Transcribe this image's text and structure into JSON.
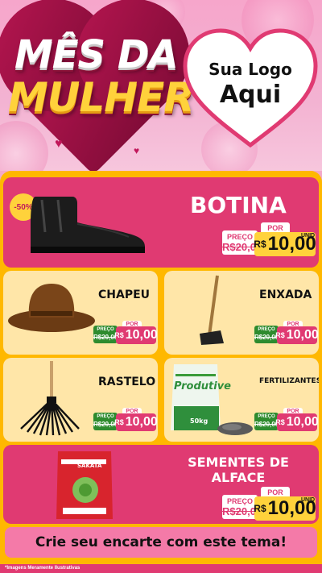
{
  "header": {
    "title_line1": "MÊS DA",
    "title_line2": "MULHER",
    "logo_line1": "Sua Logo",
    "logo_line2": "Aqui"
  },
  "products": [
    {
      "name": "BOTINA",
      "badge": "-50%",
      "por": "POR",
      "old_label": "PREÇO",
      "old_price": "R$20,00",
      "currency": "R$",
      "new_price": "10,00",
      "unit": "UNID"
    },
    {
      "name": "CHAPEU",
      "por": "POR",
      "old_label": "PREÇO",
      "old_price": "R$20,00",
      "currency": "R$",
      "new_price": "10,00"
    },
    {
      "name": "ENXADA",
      "por": "POR",
      "old_label": "PREÇO",
      "old_price": "R$20,00",
      "currency": "R$",
      "new_price": "10,00"
    },
    {
      "name": "RASTELO",
      "por": "POR",
      "old_label": "PREÇO",
      "old_price": "R$20,00",
      "currency": "R$",
      "new_price": "10,00"
    },
    {
      "name": "FERTILIZANTES",
      "por": "POR",
      "old_label": "PREÇO",
      "old_price": "R$20,00",
      "currency": "R$",
      "new_price": "10,00",
      "package_brand": "Produtive",
      "package_weight": "50kg"
    },
    {
      "name": "SEMENTES DE ALFACE",
      "por": "POR",
      "old_label": "PREÇO",
      "old_price": "R$20,00",
      "currency": "R$",
      "new_price": "10,00",
      "unit": "UNID",
      "package_brand": "SAKATA"
    }
  ],
  "cta": "Crie seu encarte com este tema!",
  "footer": "*Imagens Meramente Ilustrativas",
  "colors": {
    "pink_panel": "#e03a72",
    "cream_panel": "#ffe6a8",
    "board": "#ffb800",
    "price_yellow": "#ffd23b",
    "cta": "#f47aa8"
  }
}
